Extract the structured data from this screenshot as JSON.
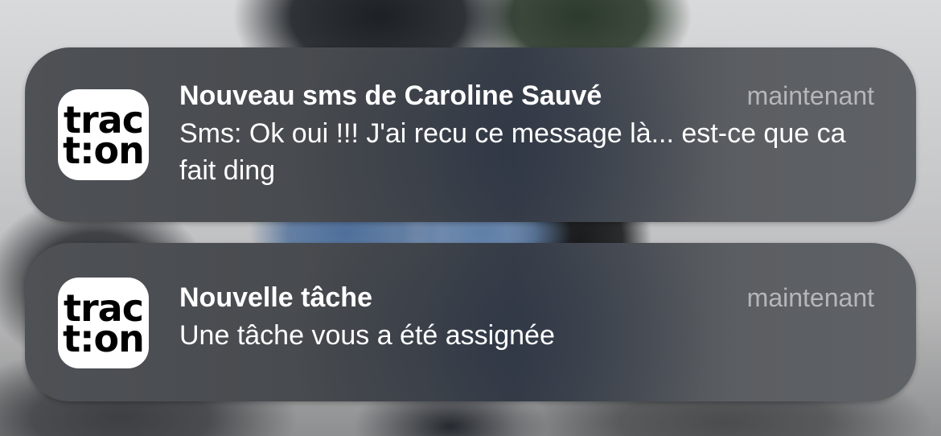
{
  "notifications": [
    {
      "app_icon": {
        "line1": "trac",
        "line2": "t:on"
      },
      "title": "Nouveau sms de Caroline Sauvé",
      "time": "maintenant",
      "body": "Sms: Ok oui !!! J'ai recu ce message là... est-ce que ca fait ding"
    },
    {
      "app_icon": {
        "line1": "trac",
        "line2": "t:on"
      },
      "title": "Nouvelle tâche",
      "time": "maintenant",
      "body": "Une tâche vous a été assignée"
    }
  ],
  "colors": {
    "card_background": "#4a4d52",
    "title": "#ffffff",
    "time": "#a6a7aa",
    "icon_background": "#ffffff",
    "icon_text": "#000000"
  }
}
